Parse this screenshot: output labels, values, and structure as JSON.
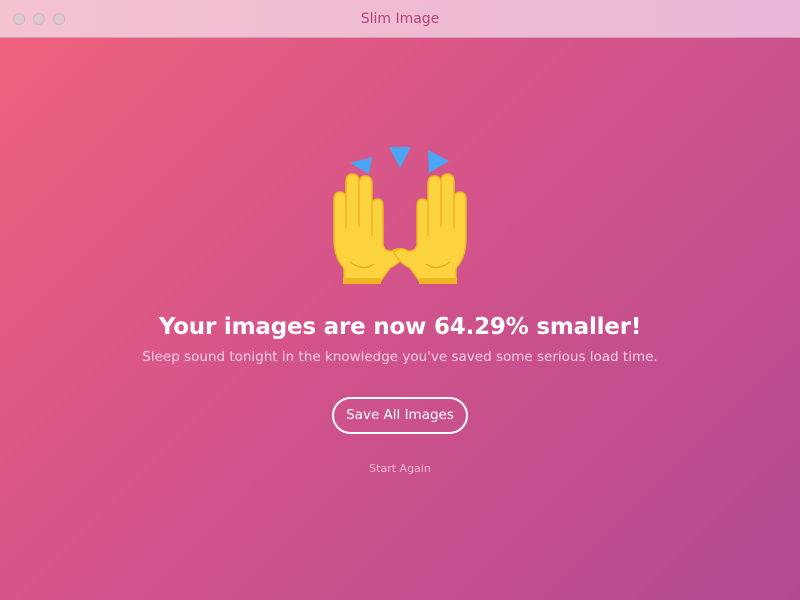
{
  "window": {
    "title": "Slim Image"
  },
  "result": {
    "emoji_icon": "raising-hands-icon",
    "headline": "Your images are now 64.29% smaller!",
    "subline": "Sleep sound tonight in the knowledge you've saved some serious load time."
  },
  "actions": {
    "save_label": "Save All Images",
    "restart_label": "Start Again"
  },
  "colors": {
    "gradient_start": "#f0627b",
    "gradient_end": "#b24a92",
    "title_text": "#b0457e",
    "sparkle": "#4aa6f2",
    "hand": "#fbd33f"
  }
}
